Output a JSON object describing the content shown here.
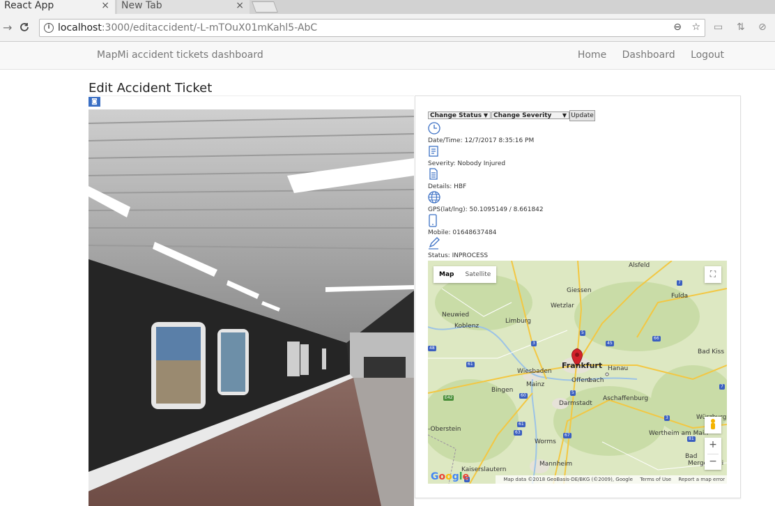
{
  "browser": {
    "tabs": [
      {
        "label": "React App"
      },
      {
        "label": "New Tab"
      }
    ],
    "close_glyph": "×",
    "url_host": "localhost",
    "url_rest": ":3000/editaccident/-L-mTOuX01mKahl5-AbC"
  },
  "appnav": {
    "brand": "MapMi accident tickets dashboard",
    "links": [
      "Home",
      "Dashboard",
      "Logout"
    ]
  },
  "page": {
    "title": "Edit Accident Ticket"
  },
  "controls": {
    "status_select": "Change Status",
    "severity_select": "Change Severity",
    "update_button": "Update"
  },
  "details": {
    "datetime": "Date/Time: 12/7/2017 8:35:16 PM",
    "severity": "Severity: Nobody Injured",
    "details": "Details: HBF",
    "gps": "GPS(lat/lng): 50.1095149 / 8.661842",
    "mobile": "Mobile: 01648637484",
    "status": "Status: INPROCESS"
  },
  "map": {
    "tab_map": "Map",
    "tab_satellite": "Satellite",
    "attribution": "Map data ©2018 GeoBasis-DE/BKG (©2009), Google",
    "terms": "Terms of Use",
    "report": "Report a map error",
    "logo": "Google",
    "cities": {
      "alsfeld": "Alsfeld",
      "giessen": "Giessen",
      "wetzlar": "Wetzlar",
      "fulda": "Fulda",
      "neuwied": "Neuwied",
      "koblenz": "Koblenz",
      "limburg": "Limburg",
      "badkiss": "Bad Kiss",
      "frankfurt": "Frankfurt",
      "hanau": "Hanau",
      "wiesbaden": "Wiesbaden",
      "offenbach": "Offenbach",
      "mainz": "Mainz",
      "bingen": "Bingen",
      "darmstadt": "Darmstadt",
      "aschaffenburg": "Aschaffenburg",
      "oberstein": "-Oberstein",
      "worms": "Worms",
      "wurzburg": "Würzburg",
      "wertheim": "Wertheim am Main",
      "mannheim": "Mannheim",
      "bad": "Bad",
      "mergentheim": "Mergenthei",
      "kaiserslautern": "Kaiserslautern"
    },
    "highways": {
      "h7a": "7",
      "h7b": "7",
      "h66": "66",
      "h5a": "5",
      "h45": "45",
      "h3a": "3",
      "h61a": "61",
      "h48": "48",
      "h60": "60",
      "h5b": "5",
      "h67": "67",
      "hE42": "E42",
      "h63": "63",
      "h61b": "61",
      "h3b": "3",
      "h81": "81",
      "h6": "6"
    }
  }
}
